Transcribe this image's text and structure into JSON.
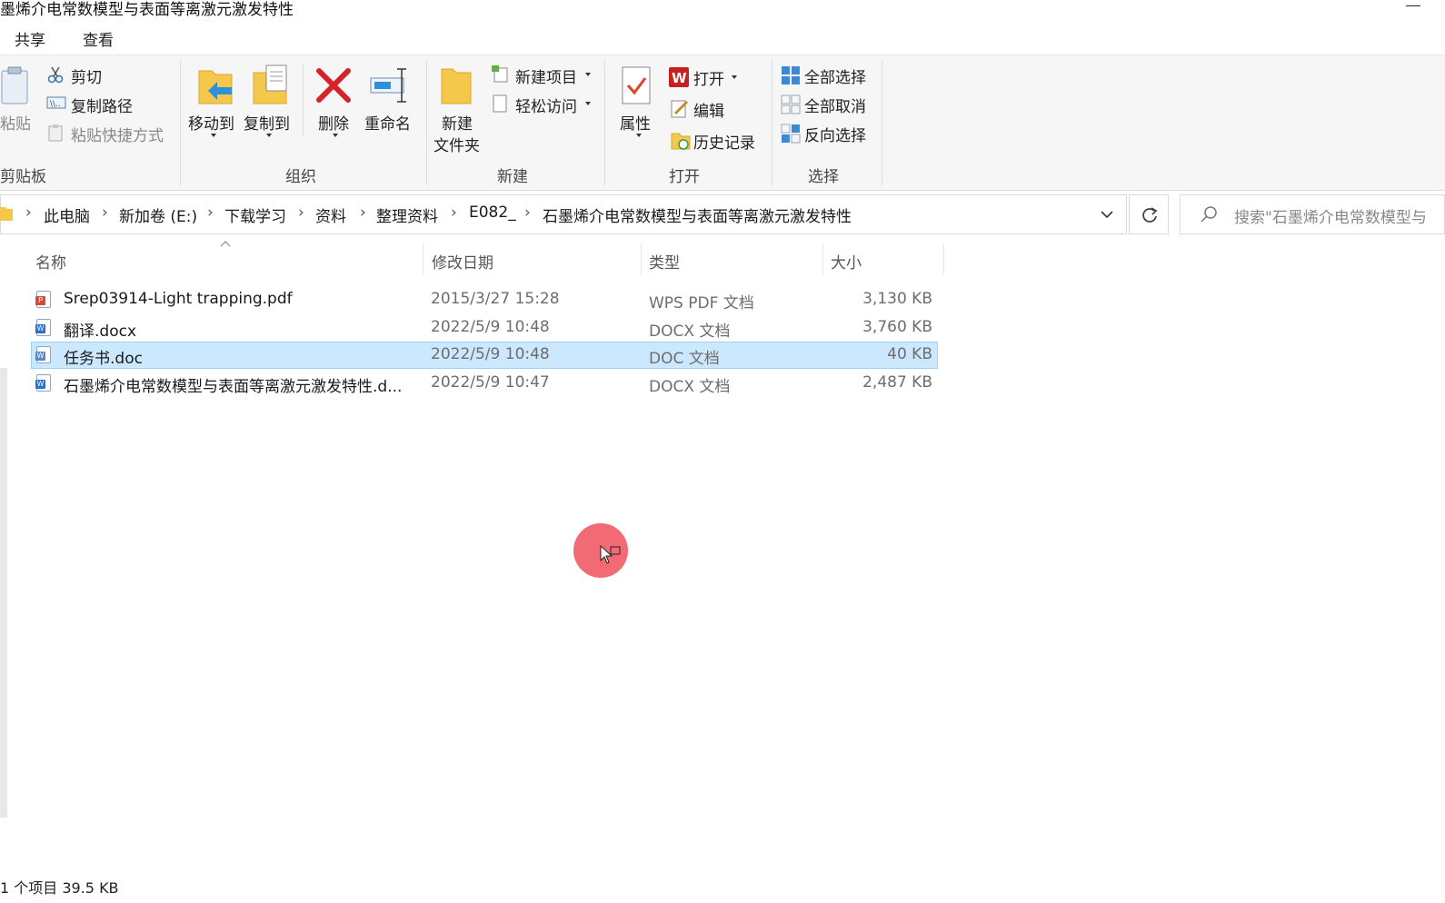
{
  "window": {
    "title": "墨烯介电常数模型与表面等离激元激发特性"
  },
  "menu": {
    "tabs": [
      "共享",
      "查看"
    ]
  },
  "ribbon": {
    "clipboard": {
      "paste": "粘贴",
      "cut": "剪切",
      "copy_path": "复制路径",
      "paste_shortcut": "粘贴快捷方式",
      "group_label": "剪贴板"
    },
    "organize": {
      "move_to": "移动到",
      "copy_to": "复制到",
      "delete": "删除",
      "rename": "重命名",
      "group_label": "组织"
    },
    "new": {
      "new_folder_line1": "新建",
      "new_folder_line2": "文件夹",
      "new_item": "新建项目",
      "easy_access": "轻松访问",
      "group_label": "新建"
    },
    "open": {
      "properties": "属性",
      "open": "打开",
      "edit": "编辑",
      "history": "历史记录",
      "group_label": "打开"
    },
    "select": {
      "select_all": "全部选择",
      "select_none": "全部取消",
      "invert": "反向选择",
      "group_label": "选择"
    }
  },
  "address": {
    "crumbs": [
      "此电脑",
      "新加卷 (E:)",
      "下载学习",
      "资料",
      "整理资料",
      "E082_",
      "石墨烯介电常数模型与表面等离激元激发特性"
    ]
  },
  "search": {
    "placeholder": "搜索\"石墨烯介电常数模型与"
  },
  "columns": {
    "name": "名称",
    "date": "修改日期",
    "type": "类型",
    "size": "大小"
  },
  "files": [
    {
      "name": "Srep03914-Light trapping.pdf",
      "date": "2015/3/27 15:28",
      "type": "WPS PDF 文档",
      "size": "3,130 KB",
      "icon": "pdf-file-icon",
      "selected": false
    },
    {
      "name": "翻译.docx",
      "date": "2022/5/9 10:48",
      "type": "DOCX 文档",
      "size": "3,760 KB",
      "icon": "word-file-icon",
      "selected": false
    },
    {
      "name": "任务书.doc",
      "date": "2022/5/9 10:48",
      "type": "DOC 文档",
      "size": "40 KB",
      "icon": "word-file-icon",
      "selected": true
    },
    {
      "name": "石墨烯介电常数模型与表面等离激元激发特性.d...",
      "date": "2022/5/9 10:47",
      "type": "DOCX 文档",
      "size": "2,487 KB",
      "icon": "word-file-icon",
      "selected": false
    }
  ],
  "status": {
    "text": "1 个项目  39.5 KB"
  },
  "colors": {
    "selection_bg": "#cce8ff",
    "selection_border": "#99d1ff",
    "cursor_highlight": "#f0505a",
    "delete_red": "#d4242a"
  }
}
